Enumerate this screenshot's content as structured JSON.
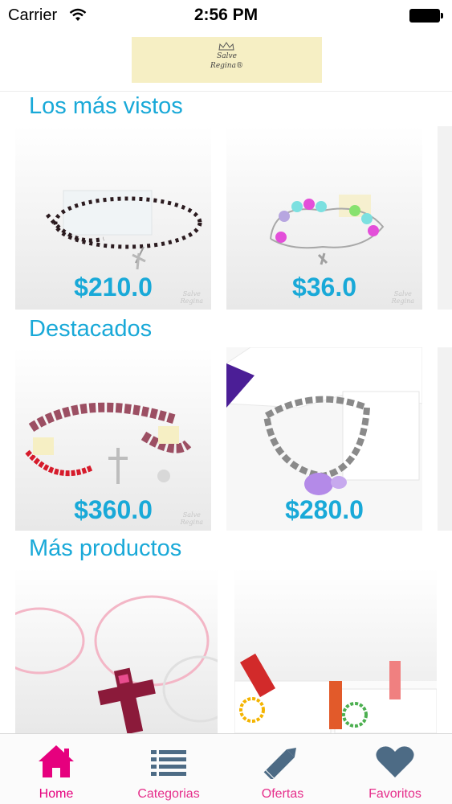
{
  "status_bar": {
    "carrier": "Carrier",
    "time": "2:56 PM"
  },
  "header": {
    "logo_line1": "Salve",
    "logo_line2": "Regina®"
  },
  "sections": {
    "most_viewed": {
      "title": "Los más vistos",
      "prices": [
        "$210.0",
        "$36.0"
      ]
    },
    "featured": {
      "title": "Destacados",
      "prices": [
        "$360.0",
        "$280.0"
      ]
    },
    "more_products": {
      "title": "Más productos"
    }
  },
  "tabs": [
    {
      "label": "Home",
      "icon": "home-icon",
      "active": true
    },
    {
      "label": "Categorias",
      "icon": "list-icon",
      "active": false
    },
    {
      "label": "Ofertas",
      "icon": "pencil-icon",
      "active": false
    },
    {
      "label": "Favoritos",
      "icon": "heart-icon",
      "active": false
    }
  ],
  "colors": {
    "accent": "#19a9d8",
    "brand_pink": "#e6007e",
    "tab_icon": "#4d6b85",
    "logo_bg": "#f6efc4"
  }
}
